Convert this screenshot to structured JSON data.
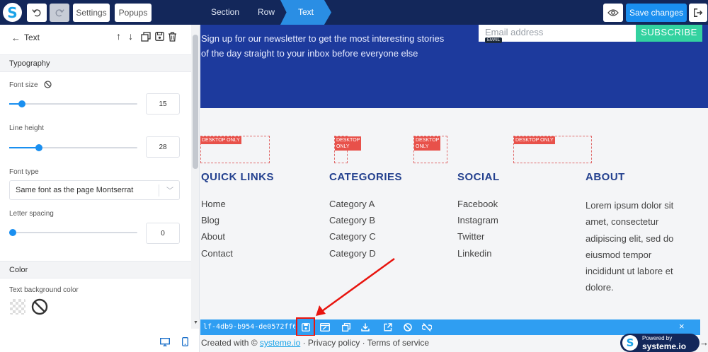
{
  "topbar": {
    "logo_letter": "S",
    "undo_icon": "undo-icon",
    "redo_icon": "redo-icon",
    "settings_label": "Settings",
    "popups_label": "Popups",
    "breadcrumbs": [
      "Section",
      "Row",
      "Text"
    ],
    "preview_icon": "eye-icon",
    "save_label": "Save changes",
    "exit_icon": "exit-icon"
  },
  "panel": {
    "title": "Text",
    "actions": [
      "move-up-icon",
      "move-down-icon",
      "duplicate-icon",
      "save-icon",
      "delete-icon"
    ],
    "typography_header": "Typography",
    "font_size_label": "Font size",
    "font_size_value": "15",
    "font_size_level": 0.1,
    "line_height_label": "Line height",
    "line_height_value": "28",
    "line_height_level": 0.23,
    "font_type_label": "Font type",
    "font_type_value": "Same font as the page Montserrat",
    "letter_spacing_label": "Letter spacing",
    "letter_spacing_value": "0",
    "letter_spacing_level": 0.03,
    "color_header": "Color",
    "text_bg_label": "Text background color",
    "device_icons": [
      "desktop-icon",
      "mobile-icon"
    ]
  },
  "canvas": {
    "newsletter_text": "Sign up for our newsletter to get the most interesting stories of the day straight to your inbox before everyone else",
    "email_placeholder": "Email address",
    "email_tag": "EMAIL",
    "subscribe_label": "SUBSCRIBE",
    "desktop_only_badge": "DESKTOP ONLY",
    "desktop_badge_line1": "DESKTOP",
    "desktop_badge_line2": "ONLY",
    "columns": {
      "quick_links": {
        "title": "QUICK LINKS",
        "items": [
          "Home",
          "Blog",
          "About",
          "Contact"
        ]
      },
      "categories": {
        "title": "CATEGORIES",
        "items": [
          "Category A",
          "Category B",
          "Category C",
          "Category D"
        ]
      },
      "social": {
        "title": "SOCIAL",
        "items": [
          "Facebook",
          "Instagram",
          "Twitter",
          "Linkedin"
        ]
      },
      "about": {
        "title": "ABOUT",
        "text": "Lorem ipsum dolor sit amet, consectetur adipiscing elit, sed do eiusmod tempor incididunt ut labore et dolore."
      }
    }
  },
  "element_toolbar": {
    "element_id": "lf-4db9-b954-de0572ff6508",
    "tools": [
      "save-as-block-icon",
      "edit-icon",
      "copy-icon",
      "download-icon",
      "external-link-icon",
      "block-icon",
      "unlink-icon"
    ],
    "close_label": "×"
  },
  "footer": {
    "created_prefix": "Created with ©",
    "brand_link": "systeme.io",
    "rest": " · Privacy policy · Terms of service",
    "powered_by": "Powered by",
    "powered_brand": "systeme.io"
  },
  "colors": {
    "topbar": "#13275a",
    "accent": "#1a8ff0",
    "hero": "#1d3a9d",
    "heading": "#24418f",
    "subscribe": "#33d2a0",
    "badge": "#e8514a",
    "highlight": "#e8140e"
  }
}
